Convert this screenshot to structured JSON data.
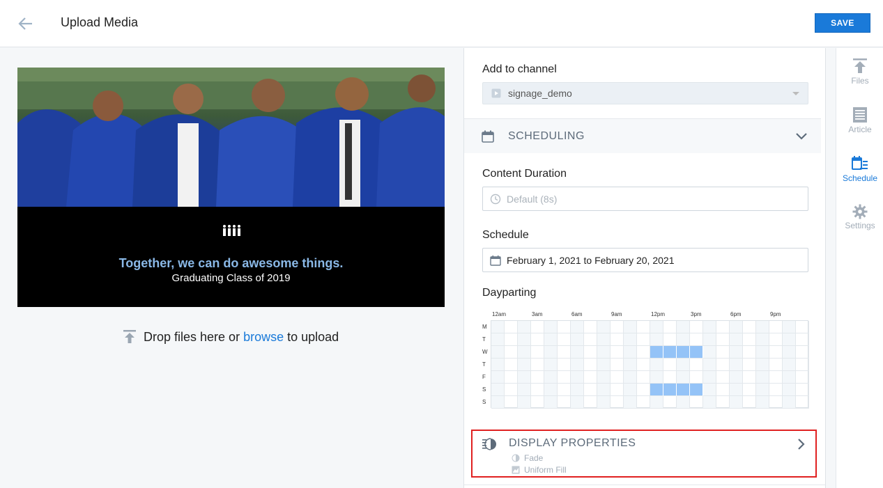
{
  "header": {
    "title": "Upload Media",
    "save_label": "SAVE"
  },
  "preview": {
    "tagline": "Together, we can do awesome things.",
    "subline": "Graduating Class of 2019"
  },
  "upload": {
    "prefix": "Drop files here or ",
    "link": "browse",
    "suffix": " to upload"
  },
  "channel": {
    "label": "Add to channel",
    "value": "signage_demo"
  },
  "scheduling": {
    "header": "SCHEDULING",
    "duration_label": "Content Duration",
    "duration_placeholder": "Default (8s)",
    "schedule_label": "Schedule",
    "schedule_value": "February 1, 2021 to February 20, 2021",
    "dayparting_label": "Dayparting",
    "hour_labels": [
      "12am",
      "3am",
      "6am",
      "9am",
      "12pm",
      "3pm",
      "6pm",
      "9pm"
    ],
    "day_labels": [
      "M",
      "T",
      "W",
      "T",
      "F",
      "S",
      "S"
    ],
    "active_days": [
      2,
      5
    ],
    "active_columns": [
      12,
      13,
      14,
      15
    ]
  },
  "display_properties": {
    "header": "DISPLAY PROPERTIES",
    "transition": "Fade",
    "fill": "Uniform Fill"
  },
  "rail": [
    {
      "label": "Files",
      "icon": "upload-icon",
      "active": false
    },
    {
      "label": "Article",
      "icon": "article-icon",
      "active": false
    },
    {
      "label": "Schedule",
      "icon": "schedule-icon",
      "active": true
    },
    {
      "label": "Settings",
      "icon": "gear-icon",
      "active": false
    }
  ],
  "colors": {
    "accent": "#1a7ad9",
    "highlight": "#e02020",
    "dayparting_on": "#94c3f7"
  }
}
